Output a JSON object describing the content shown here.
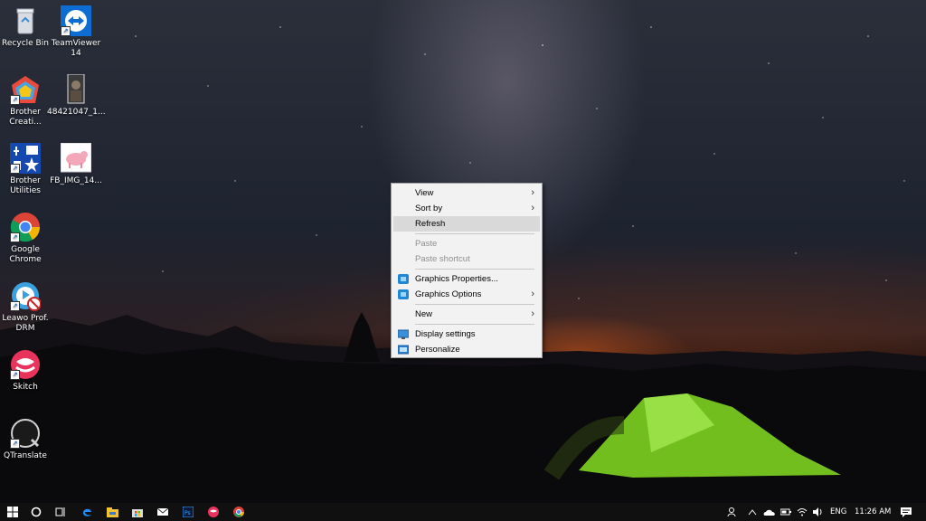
{
  "desktop_icons": [
    {
      "label": "Recycle Bin"
    },
    {
      "label": "TeamViewer 14"
    },
    {
      "label": "Brother Creati..."
    },
    {
      "label": "48421047_1..."
    },
    {
      "label": "Brother Utilities"
    },
    {
      "label": "FB_IMG_14..."
    },
    {
      "label": "Google Chrome"
    },
    {
      "label": "Leawo Prof. DRM"
    },
    {
      "label": "Skitch"
    },
    {
      "label": "QTranslate"
    }
  ],
  "context_menu": {
    "items": [
      {
        "label": "View",
        "submenu": true
      },
      {
        "label": "Sort by",
        "submenu": true
      },
      {
        "label": "Refresh",
        "highlighted": true
      },
      {
        "label": "Paste",
        "disabled": true
      },
      {
        "label": "Paste shortcut",
        "disabled": true
      },
      {
        "label": "Graphics Properties...",
        "icon": "intel-graphics-icon"
      },
      {
        "label": "Graphics Options",
        "icon": "intel-graphics-icon",
        "submenu": true
      },
      {
        "label": "New",
        "submenu": true
      },
      {
        "label": "Display settings",
        "icon": "display-icon"
      },
      {
        "label": "Personalize",
        "icon": "personalize-icon"
      }
    ]
  },
  "taskbar": {
    "apps": [
      "start-icon",
      "cortana-icon",
      "task-view-icon",
      "edge-icon",
      "file-explorer-icon",
      "store-icon",
      "mail-icon",
      "photoshop-icon",
      "skitch-icon",
      "chrome-icon"
    ],
    "tray": {
      "language": "ENG",
      "time": "11:26 AM"
    }
  },
  "colors": {
    "menu_background": "#f2f2f2",
    "menu_highlight": "#d9d9d9",
    "taskbar": "#101010",
    "tent": "#7ed321"
  }
}
